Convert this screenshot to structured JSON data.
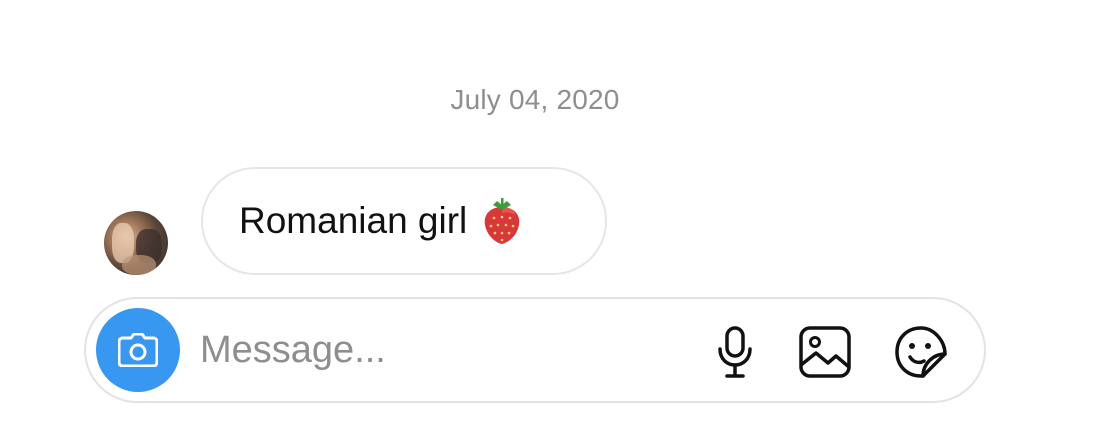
{
  "thread": {
    "date_separator": "July 04, 2020",
    "messages": [
      {
        "direction": "incoming",
        "text": "Romanian girl",
        "emoji_icon": "strawberry-icon"
      }
    ]
  },
  "composer": {
    "placeholder": "Message...",
    "value": "",
    "camera_icon": "camera-icon",
    "actions": [
      {
        "icon": "microphone-icon"
      },
      {
        "icon": "gallery-icon"
      },
      {
        "icon": "sticker-icon"
      }
    ]
  },
  "colors": {
    "accent": "#3897f0",
    "date_text": "#8e8e8e",
    "bubble_border": "#e6e6e6",
    "text": "#111111"
  }
}
